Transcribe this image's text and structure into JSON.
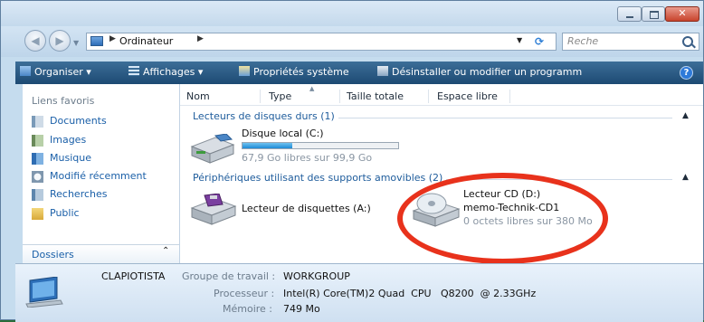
{
  "address": {
    "location": "Ordinateur"
  },
  "search": {
    "placeholder": "Reche"
  },
  "toolbar": {
    "organiser": "Organiser",
    "affichages": "Affichages",
    "proprietes": "Propriétés système",
    "desinstaller": "Désinstaller ou modifier un programm"
  },
  "sidebar": {
    "header": "Liens favoris",
    "items": [
      {
        "label": "Documents",
        "icon": "documents-icon"
      },
      {
        "label": "Images",
        "icon": "images-icon"
      },
      {
        "label": "Musique",
        "icon": "music-icon"
      },
      {
        "label": "Modifié récemment",
        "icon": "recent-icon"
      },
      {
        "label": "Recherches",
        "icon": "searches-icon"
      },
      {
        "label": "Public",
        "icon": "public-folder-icon"
      }
    ],
    "folders_label": "Dossiers"
  },
  "columns": [
    "Nom",
    "Type",
    "Taille totale",
    "Espace libre"
  ],
  "groups": [
    {
      "title": "Lecteurs de disques durs (1)",
      "items": [
        {
          "name": "Disque local (C:)",
          "free_text": "67,9 Go libres sur 99,9 Go",
          "used_fraction": 0.32
        }
      ]
    },
    {
      "title": "Périphériques utilisant des supports amovibles (2)",
      "items": [
        {
          "name": "Lecteur de disquettes (A:)"
        },
        {
          "name": "Lecteur CD (D:)",
          "label": "memo-Technik-CD1",
          "free_text": "0 octets libres sur 380 Mo"
        }
      ]
    }
  ],
  "details": {
    "computer_name": "CLAPIOTISTA",
    "workgroup_label": "Groupe de travail :",
    "workgroup_value": "WORKGROUP",
    "cpu_label": "Processeur :",
    "cpu_value": "Intel(R) Core(TM)2 Quad  CPU   Q8200  @ 2.33GHz",
    "memory_label": "Mémoire :",
    "memory_value": "749 Mo"
  },
  "colors": {
    "toolbar": "#2a5a85",
    "link": "#1a5fa8",
    "annotation": "#e8321c",
    "progress": "#1d8ad6"
  }
}
